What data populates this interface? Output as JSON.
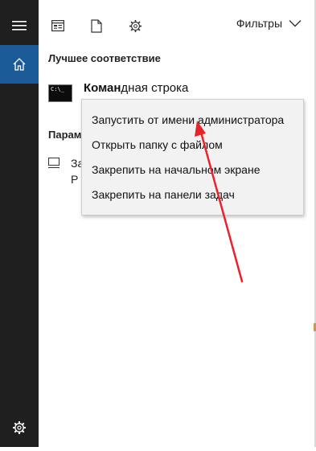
{
  "sidebar": {
    "hamburger_icon": "hamburger-menu-icon",
    "home_icon": "home-icon",
    "settings_icon": "gear-icon",
    "active_color": "#1a5a96",
    "background_color": "#1f1f1f"
  },
  "toolbar": {
    "icons": [
      "apps-icon",
      "document-icon",
      "gear-icon"
    ],
    "filters_label": "Фильтры",
    "filters_icon": "chevron-down-icon"
  },
  "best_match": {
    "heading": "Лучшее соответствие",
    "result": {
      "icon": "command-prompt-icon",
      "icon_text": "C:\\_",
      "name_bold": "Коман",
      "name_rest": "дная строка"
    }
  },
  "settings_section": {
    "heading_partial": "Парам",
    "item": {
      "icon": "monitor-icon",
      "line1": "За",
      "line2": "Р"
    }
  },
  "context_menu": {
    "items": [
      "Запустить от имени администратора",
      "Открыть папку с файлом",
      "Закрепить на начальном экране",
      "Закрепить на панели задач"
    ]
  },
  "annotation": {
    "arrow_color": "#e8232a"
  }
}
